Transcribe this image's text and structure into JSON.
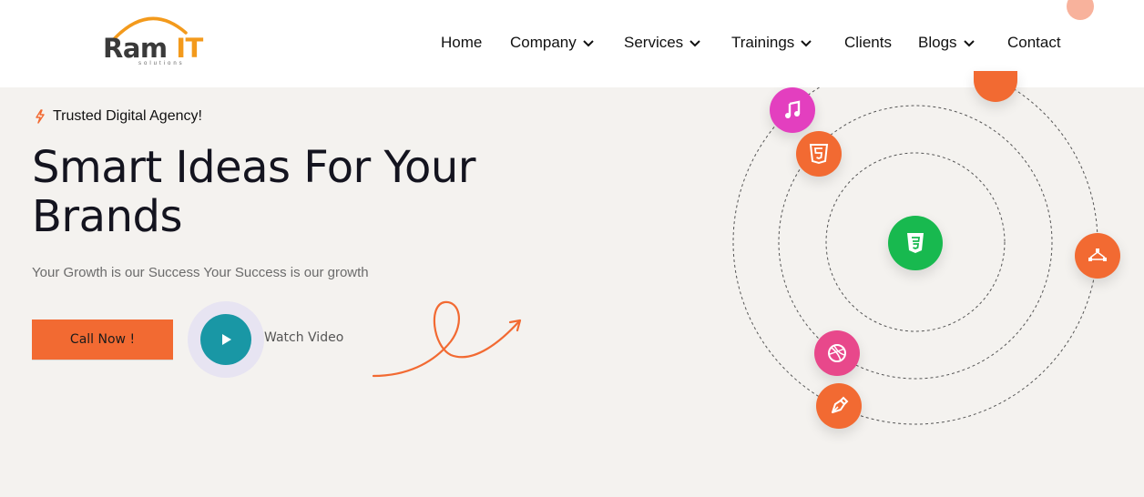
{
  "header": {
    "logo": {
      "main": "Ram",
      "accent": "IT",
      "sub": "solutions"
    },
    "nav": [
      {
        "label": "Home",
        "dropdown": false
      },
      {
        "label": "Company",
        "dropdown": true
      },
      {
        "label": "Services",
        "dropdown": true
      },
      {
        "label": "Trainings",
        "dropdown": true
      },
      {
        "label": "Clients",
        "dropdown": false
      },
      {
        "label": "Blogs",
        "dropdown": true
      },
      {
        "label": "Contact",
        "dropdown": false
      }
    ]
  },
  "hero": {
    "badge": "Trusted Digital Agency!",
    "title_line1": "Smart Ideas For Your",
    "title_line2": "Brands",
    "subtitle": "Your Growth is our Success Your Success is our growth",
    "cta": "Call Now !",
    "video_label": "Watch Video"
  },
  "orbit_icons": [
    {
      "name": "music-note-icon",
      "color": "#e33fbf"
    },
    {
      "name": "html5-icon",
      "color": "#f26a32"
    },
    {
      "name": "css3-icon",
      "color": "#18b94f"
    },
    {
      "name": "vector-nodes-icon",
      "color": "#f26a32"
    },
    {
      "name": "dribbble-icon",
      "color": "#e8488b"
    },
    {
      "name": "pen-nib-icon",
      "color": "#f26a32"
    },
    {
      "name": "top-orange-icon",
      "color": "#f26a32"
    }
  ],
  "colors": {
    "accent": "#f26a32",
    "play": "#1997a5",
    "logo_accent": "#f39a1c",
    "background": "#f4f2ef"
  }
}
